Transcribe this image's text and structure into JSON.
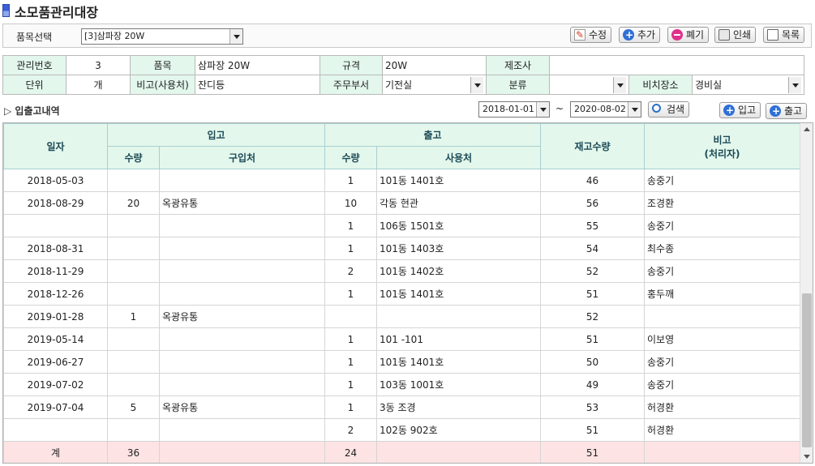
{
  "title": "소모품관리대장",
  "toolbar": {
    "item_label": "품목선택",
    "item_value": "[3]삼파장 20W",
    "edit_label": "수정",
    "add_label": "추가",
    "discard_label": "폐기",
    "print_label": "인쇄",
    "list_label": "목록"
  },
  "info": {
    "mgmt_no_label": "관리번호",
    "mgmt_no": "3",
    "item_label": "품목",
    "item": "삼파장 20W",
    "spec_label": "규격",
    "spec": "20W",
    "maker_label": "제조사",
    "maker": "",
    "unit_label": "단위",
    "unit": "개",
    "note_label": "비고(사용처)",
    "note": "잔디등",
    "dept_label": "주무부서",
    "dept": "기전실",
    "category_label": "분류",
    "category": "",
    "location_label": "비치장소",
    "location": "경비실"
  },
  "history": {
    "label": "▷ 입출고내역",
    "date_from": "2018-01-01",
    "tilde": "~",
    "date_to": "2020-08-02",
    "search_label": "검색",
    "in_label": "입고",
    "out_label": "출고"
  },
  "grid": {
    "headers": {
      "date": "일자",
      "in": "입고",
      "out": "출고",
      "stock": "재고수량",
      "note_line1": "비고",
      "note_line2": "(처리자)",
      "in_qty": "수량",
      "in_source": "구입처",
      "out_qty": "수량",
      "out_place": "사용처"
    },
    "rows": [
      {
        "date": "2018-05-03",
        "in_qty": "",
        "in_source": "",
        "out_qty": "1",
        "out_place": "101동 1401호",
        "stock": "46",
        "note": "송중기"
      },
      {
        "date": "2018-08-29",
        "in_qty": "20",
        "in_source": "옥광유통",
        "out_qty": "10",
        "out_place": "각동 현관",
        "stock": "56",
        "note": "조경환"
      },
      {
        "date": "",
        "in_qty": "",
        "in_source": "",
        "out_qty": "1",
        "out_place": "106동 1501호",
        "stock": "55",
        "note": "송중기"
      },
      {
        "date": "2018-08-31",
        "in_qty": "",
        "in_source": "",
        "out_qty": "1",
        "out_place": "101동 1403호",
        "stock": "54",
        "note": "최수종"
      },
      {
        "date": "2018-11-29",
        "in_qty": "",
        "in_source": "",
        "out_qty": "2",
        "out_place": "101동 1402호",
        "stock": "52",
        "note": "송중기"
      },
      {
        "date": "2018-12-26",
        "in_qty": "",
        "in_source": "",
        "out_qty": "1",
        "out_place": "101동 1401호",
        "stock": "51",
        "note": "홍두깨"
      },
      {
        "date": "2019-01-28",
        "in_qty": "1",
        "in_source": "옥광유통",
        "out_qty": "",
        "out_place": "",
        "stock": "52",
        "note": ""
      },
      {
        "date": "2019-05-14",
        "in_qty": "",
        "in_source": "",
        "out_qty": "1",
        "out_place": "101 -101",
        "stock": "51",
        "note": "이보영"
      },
      {
        "date": "2019-06-27",
        "in_qty": "",
        "in_source": "",
        "out_qty": "1",
        "out_place": "101동 1401호",
        "stock": "50",
        "note": "송중기"
      },
      {
        "date": "2019-07-02",
        "in_qty": "",
        "in_source": "",
        "out_qty": "1",
        "out_place": "103동 1001호",
        "stock": "49",
        "note": "송중기"
      },
      {
        "date": "2019-07-04",
        "in_qty": "5",
        "in_source": "옥광유통",
        "out_qty": "1",
        "out_place": "3동 조경",
        "stock": "53",
        "note": "허경환"
      },
      {
        "date": "",
        "in_qty": "",
        "in_source": "",
        "out_qty": "2",
        "out_place": "102동 902호",
        "stock": "51",
        "note": "허경환"
      }
    ],
    "total": {
      "date": "계",
      "in_qty": "36",
      "in_source": "",
      "out_qty": "24",
      "out_place": "",
      "stock": "51",
      "note": ""
    }
  }
}
